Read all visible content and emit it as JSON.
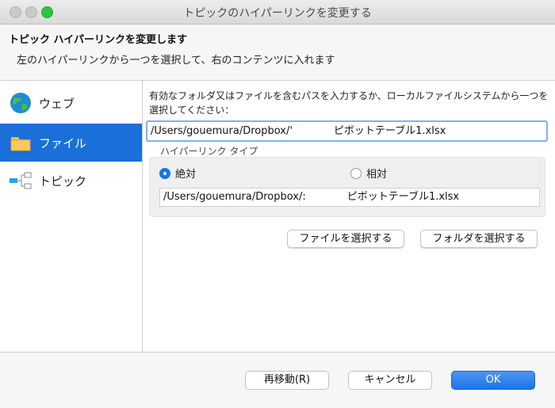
{
  "window": {
    "title": "トピックのハイパーリンクを変更する"
  },
  "header": {
    "title": "トピック ハイパーリンクを変更します",
    "description": "左のハイパーリンクから一つを選択して、右のコンテンツに入れます"
  },
  "sidebar": {
    "items": [
      {
        "label": "ウェブ",
        "icon": "globe-icon",
        "selected": false
      },
      {
        "label": "ファイル",
        "icon": "folder-icon",
        "selected": true
      },
      {
        "label": "トピック",
        "icon": "topic-icon",
        "selected": false
      }
    ]
  },
  "main": {
    "prompt": "有効なフォルダ又はファイルを含むパスを入力するか、ローカルファイルシステムから一つを選択してください：",
    "path_value": "/Users/gouemura/Dropbox/'　　　　ピボットテーブル1.xlsx",
    "hyperlink_type_label": "ハイパーリンク タイプ",
    "radio_absolute": "絶対",
    "radio_relative": "相対",
    "absolute_selected": true,
    "resolved_path": "/Users/gouemura/Dropbox/:　　　　ピボットテーブル1.xlsx",
    "choose_file_button": "ファイルを選択する",
    "choose_folder_button": "フォルダを選択する"
  },
  "footer": {
    "reset_button": "再移動(R)",
    "cancel_button": "キャンセル",
    "ok_button": "OK"
  },
  "colors": {
    "selection": "#1a6fd8",
    "accent": "#1f73e6"
  }
}
